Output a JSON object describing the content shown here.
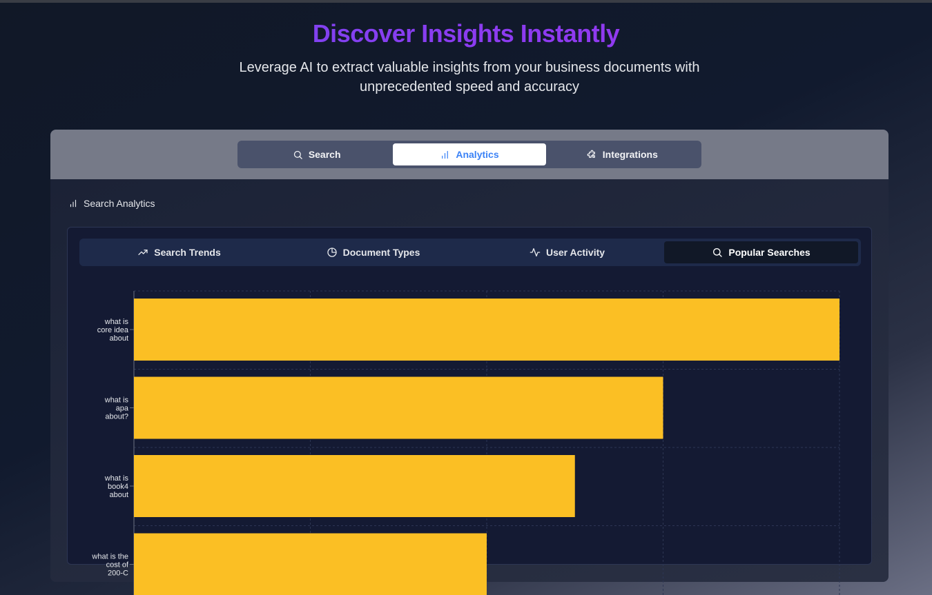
{
  "hero": {
    "title": "Discover Insights Instantly",
    "subtitle": "Leverage AI to extract valuable insights from your business documents with unprecedented speed and accuracy"
  },
  "main_tabs": [
    {
      "label": "Search",
      "icon": "search-icon"
    },
    {
      "label": "Analytics",
      "icon": "bar-chart-icon",
      "active": true
    },
    {
      "label": "Integrations",
      "icon": "puzzle-icon"
    }
  ],
  "section": {
    "title": "Search Analytics",
    "icon": "bar-chart-icon"
  },
  "sub_tabs": [
    {
      "label": "Search Trends",
      "icon": "trending-up-icon"
    },
    {
      "label": "Document Types",
      "icon": "pie-chart-icon"
    },
    {
      "label": "User Activity",
      "icon": "activity-icon"
    },
    {
      "label": "Popular Searches",
      "icon": "search-icon",
      "active": true
    }
  ],
  "colors": {
    "bar": "#fbbf24",
    "accent": "#3b82f6",
    "title_gradient_start": "#6d4bf0",
    "title_gradient_end": "#9b34ee"
  },
  "chart_data": {
    "type": "bar",
    "orientation": "horizontal",
    "categories": [
      [
        "what is",
        "core idea",
        "about"
      ],
      [
        "what is",
        "apa",
        "about?"
      ],
      [
        "what is",
        "book4",
        "about"
      ],
      [
        "what is the",
        "cost of",
        "200-C"
      ]
    ],
    "values": [
      8,
      6,
      5,
      4
    ],
    "xlim": [
      0,
      8
    ],
    "grid": true
  }
}
